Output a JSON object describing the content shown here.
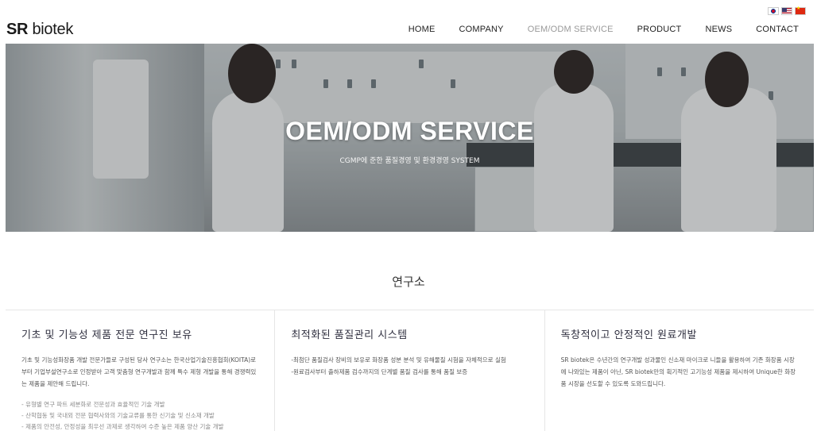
{
  "header": {
    "logo_bold": "SR",
    "logo_rest": " biotek",
    "languages": [
      "korean-flag-icon",
      "us-flag-icon",
      "china-flag-icon"
    ],
    "nav": [
      "HOME",
      "COMPANY",
      "OEM/ODM SERVICE",
      "PRODUCT",
      "NEWS",
      "CONTACT"
    ],
    "active_nav": "OEM/ODM SERVICE"
  },
  "hero": {
    "title": "OEM/ODM SERVICE",
    "subtitle": "CGMP에 준한 품질경영 및 환경경영 SYSTEM"
  },
  "section": {
    "title": "연구소"
  },
  "cards": [
    {
      "title": "기초 및 기능성 제품 전문 연구진 보유",
      "body": "기초 및 기능성화장품 개발 전문가들로 구성된 당사 연구소는 한국산업기술진흥협회(KOITA)로부터 기업부설연구소로 인정받아 고객 맞춤형 연구개발과 함께 특수 제형 개발을 통해 경쟁력있는 제품을 제안해 드립니다.",
      "bullets": [
        "유형별 연구 파트 세분화로 전문성과 효율적인 기술 개발",
        "산학협동 및 국내외 전문 협력사와의 기술교류를 통한 신기술 및 신소재 개발",
        "제품의 안전성, 안정성을 최우선 과제로 생각하여 수준 높은 제품 양산 기술 개발"
      ]
    },
    {
      "title": "최적화된 품질관리 시스템",
      "body_lines": [
        "-최첨단 품질검사 장비의 보유로 화장품 성분 분석 및 유해물질 시험을 자체적으로 실험",
        "-원료검사부터 출하제품 검수까지의 단계별 품질 검사를 통해 품질 보증"
      ]
    },
    {
      "title": "독창적이고 안정적인 원료개발",
      "body": "SR biotek은 수년간의 연구개발 성과물인 신소재 마이크로 니들을 활용하여 기존 화장품 시장에 나와있는 제품이 아닌, SR biotek만의 획기적인 고기능성 제품을 제시하여 Unique한 화장품 시장을 선도할 수 있도록 도와드립니다."
    }
  ]
}
